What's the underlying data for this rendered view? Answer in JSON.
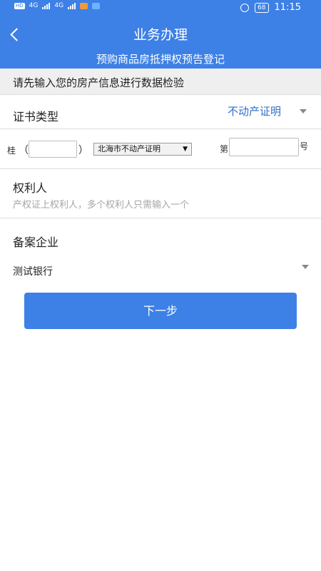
{
  "status_bar": {
    "chip1": "HD",
    "net1": "4G",
    "net2": "4G",
    "battery": "68",
    "time": "11:15"
  },
  "header": {
    "title": "业务办理",
    "subtitle": "预购商品房抵押权预告登记"
  },
  "hint_text": "请先输入您的房产信息进行数据检验",
  "certificate_type": {
    "label": "证书类型",
    "value": "不动产证明"
  },
  "cert_number": {
    "prefix": "桂",
    "paren_open": "（",
    "paren_close": "）",
    "region_select": "北海市不动产证明",
    "number_prefix": "第",
    "number_suffix": "号"
  },
  "right_holder": {
    "label": "权利人",
    "placeholder": "产权证上权利人，多个权利人只需输入一个"
  },
  "filing_company": {
    "label": "备案企业",
    "value": "测试银行"
  },
  "next_button": "下一步",
  "colors": {
    "primary": "#3d80e6",
    "link": "#2f6fc8",
    "hint_bg": "#efefef"
  }
}
